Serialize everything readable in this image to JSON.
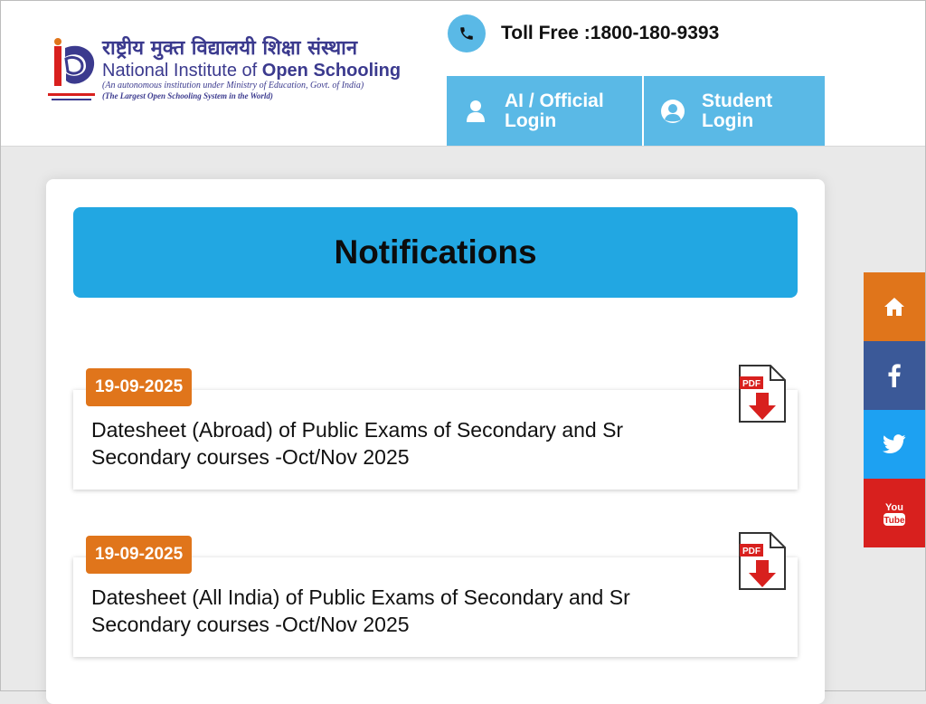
{
  "header": {
    "hindi_name": "राष्ट्रीय मुक्त विद्यालयी शिक्षा संस्थान",
    "english_name_regular": "National Institute of ",
    "english_name_bold": "Open Schooling",
    "subtitle": "(An autonomous institution under Ministry of Education, Govt. of India)",
    "tagline": "(The Largest Open Schooling System in the World)",
    "toll_free": "Toll Free :1800-180-9393",
    "ai_login_label": "AI / Official Login",
    "student_login_label": "Student Login"
  },
  "notifications": {
    "heading": "Notifications",
    "items": [
      {
        "date": "19-09-2025",
        "title": "Datesheet (Abroad) of Public Exams of Secondary and Sr Secondary courses -Oct/Nov 2025"
      },
      {
        "date": "19-09-2025",
        "title": "Datesheet (All India) of Public Exams of Secondary and Sr Secondary courses -Oct/Nov 2025"
      }
    ]
  },
  "social": {
    "icons": [
      "home-icon",
      "facebook-icon",
      "twitter-icon",
      "youtube-icon"
    ],
    "youtube_you": "You",
    "youtube_tube": "Tube"
  },
  "colors": {
    "header_blue": "#5ab9e6",
    "notif_blue": "#22a7e2",
    "badge_orange": "#e0751b",
    "brand_navy": "#3b3a8e",
    "facebook": "#3b5998",
    "twitter": "#1da1f2",
    "youtube": "#d8201e"
  }
}
